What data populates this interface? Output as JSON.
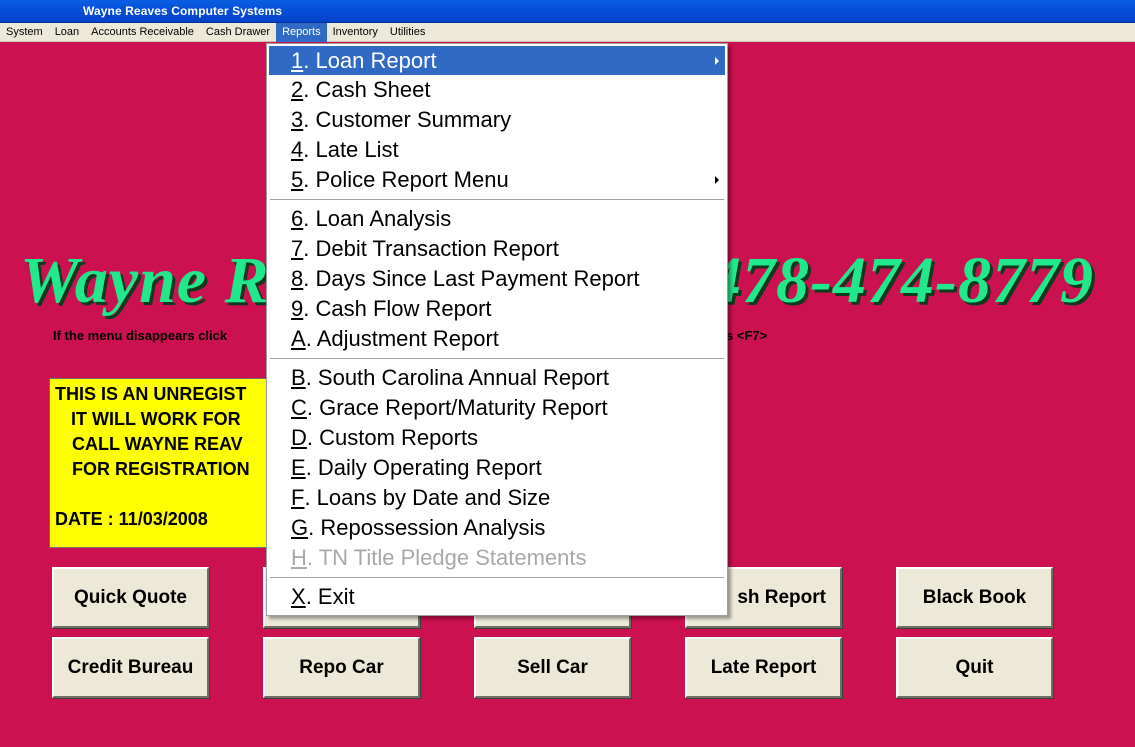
{
  "window": {
    "title": "Wayne Reaves Computer Systems"
  },
  "menubar": {
    "items": [
      "System",
      "Loan",
      "Accounts Receivable",
      "Cash Drawer",
      "Reports",
      "Inventory",
      "Utilities"
    ],
    "active": "Reports"
  },
  "banner": {
    "name_visible": "Wayne R",
    "phone_visible": "478-474-8779",
    "hint_left": "If the menu disappears click",
    "hint_right": "s  <F7>"
  },
  "registration": {
    "line1": "THIS IS AN UNREGIST",
    "line2": "IT WILL WORK FOR",
    "line3": "CALL WAYNE REAV",
    "line4": "FOR REGISTRATION",
    "date": "DATE : 11/03/2008"
  },
  "buttons": {
    "quick_quote": "Quick Quote",
    "cash_report_visible": "sh Report",
    "black_book": "Black Book",
    "credit_bureau": "Credit Bureau",
    "repo_car": "Repo Car",
    "sell_car": "Sell Car",
    "late_report": "Late Report",
    "quit": "Quit"
  },
  "reports_menu": {
    "items": [
      {
        "key": "1",
        "label": ". Loan Report"
      },
      {
        "key": "2",
        "label": ". Cash Sheet"
      },
      {
        "key": "3",
        "label": ". Customer Summary"
      },
      {
        "key": "4",
        "label": ". Late List"
      },
      {
        "key": "5",
        "label": ". Police Report Menu"
      },
      {
        "key": "6",
        "label": ". Loan Analysis"
      },
      {
        "key": "7",
        "label": ". Debit Transaction Report"
      },
      {
        "key": "8",
        "label": ". Days Since Last Payment Report"
      },
      {
        "key": "9",
        "label": ". Cash Flow Report"
      },
      {
        "key": "A",
        "label": ". Adjustment Report"
      },
      {
        "key": "B",
        "label": ". South Carolina Annual Report"
      },
      {
        "key": "C",
        "label": ". Grace Report/Maturity Report"
      },
      {
        "key": "D",
        "label": ". Custom Reports"
      },
      {
        "key": "E",
        "label": ". Daily Operating Report"
      },
      {
        "key": "F",
        "label": ". Loans by Date and Size"
      },
      {
        "key": "G",
        "label": ". Repossession Analysis"
      },
      {
        "key": "H",
        "label": ". TN Title Pledge Statements"
      },
      {
        "key": "X",
        "label": ". Exit"
      }
    ],
    "selected": "Loan Report",
    "disabled": "TN Title Pledge Statements"
  },
  "colors": {
    "background": "#CC1150",
    "title_text": "#22E88C",
    "highlight": "#316AC5",
    "registration_box": "#FFFF00"
  }
}
